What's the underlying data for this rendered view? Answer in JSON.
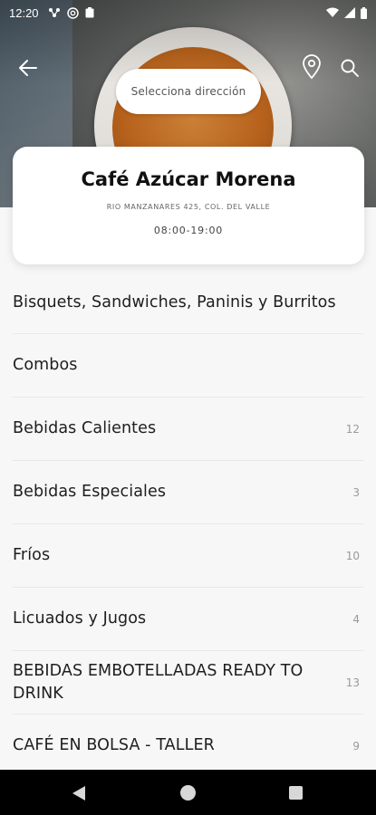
{
  "status_bar": {
    "time": "12:20"
  },
  "header": {
    "address_placeholder": "Selecciona dirección",
    "back_icon": "arrow-left-icon",
    "location_icon": "map-pin-icon",
    "search_icon": "search-icon"
  },
  "store": {
    "name": "Café Azúcar Morena",
    "address": "RIO MANZANARES 425, COL. DEL VALLE",
    "hours": "08:00-19:00"
  },
  "menu": {
    "categories": [
      {
        "label": "Bisquets, Sandwiches, Paninis y Burritos",
        "count": ""
      },
      {
        "label": "Combos",
        "count": ""
      },
      {
        "label": "Bebidas Calientes",
        "count": "12"
      },
      {
        "label": "Bebidas Especiales",
        "count": "3"
      },
      {
        "label": "Fríos",
        "count": "10"
      },
      {
        "label": "Licuados y Jugos",
        "count": "4"
      },
      {
        "label": "BEBIDAS EMBOTELLADAS READY TO DRINK",
        "count": "13"
      },
      {
        "label": "CAFÉ EN BOLSA - TALLER",
        "count": "9"
      }
    ]
  },
  "colors": {
    "background": "#f7f7f7",
    "card": "#ffffff",
    "nav_bar": "#000000"
  }
}
